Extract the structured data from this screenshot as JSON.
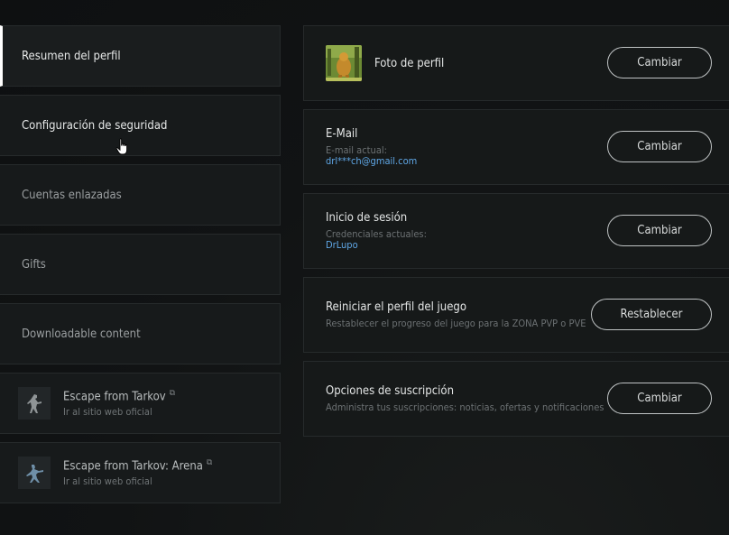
{
  "sidebar": {
    "items": [
      {
        "label": "Resumen del perfil"
      },
      {
        "label": "Configuración de seguridad"
      },
      {
        "label": "Cuentas enlazadas"
      },
      {
        "label": "Gifts"
      },
      {
        "label": "Downloadable content"
      }
    ],
    "external": [
      {
        "title": "Escape from Tarkov",
        "subtitle": "Ir al sitio web oficial"
      },
      {
        "title": "Escape from Tarkov: Arena",
        "subtitle": "Ir al sitio web oficial"
      }
    ]
  },
  "main": {
    "photo": {
      "title": "Foto de perfil",
      "button": "Cambiar"
    },
    "email": {
      "title": "E-Mail",
      "sublabel": "E-mail actual:",
      "value": "drl***ch@gmail.com",
      "button": "Cambiar"
    },
    "login": {
      "title": "Inicio de sesión",
      "sublabel": "Credenciales actuales:",
      "value": "DrLupo",
      "button": "Cambiar"
    },
    "reset": {
      "title": "Reiniciar el perfil del juego",
      "sublabel": "Restablecer el progreso del juego para la ZONA PVP o PVE",
      "button": "Restablecer"
    },
    "subscription": {
      "title": "Opciones de suscripción",
      "sublabel": "Administra tus suscripciones: noticias, ofertas y notificaciones",
      "button": "Cambiar"
    }
  },
  "colors": {
    "accent_link": "#5fa7e6",
    "active_marker": "#ffffff"
  }
}
